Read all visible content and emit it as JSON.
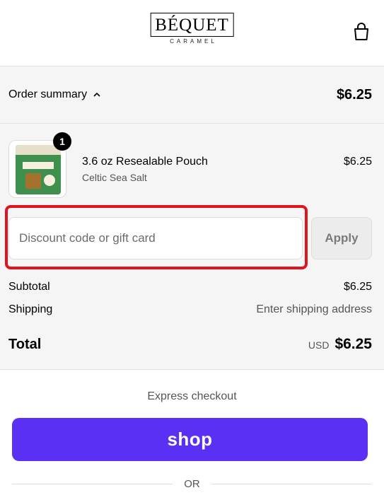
{
  "header": {
    "brand_name": "BÉQUET",
    "brand_sub": "CARAMEL"
  },
  "summary": {
    "toggle_label": "Order summary",
    "toggle_total": "$6.25"
  },
  "line_item": {
    "quantity": "1",
    "name": "3.6 oz Resealable Pouch",
    "variant": "Celtic Sea Salt",
    "price": "$6.25"
  },
  "discount": {
    "placeholder": "Discount code or gift card",
    "value": "",
    "apply_label": "Apply"
  },
  "costs": {
    "subtotal_label": "Subtotal",
    "subtotal_value": "$6.25",
    "shipping_label": "Shipping",
    "shipping_value": "Enter shipping address",
    "total_label": "Total",
    "currency": "USD",
    "total_value": "$6.25"
  },
  "express": {
    "label": "Express checkout",
    "shop_label": "shop",
    "or_label": "OR"
  },
  "colors": {
    "shop_purple": "#5a31f4",
    "highlight_red": "#e0141d"
  }
}
